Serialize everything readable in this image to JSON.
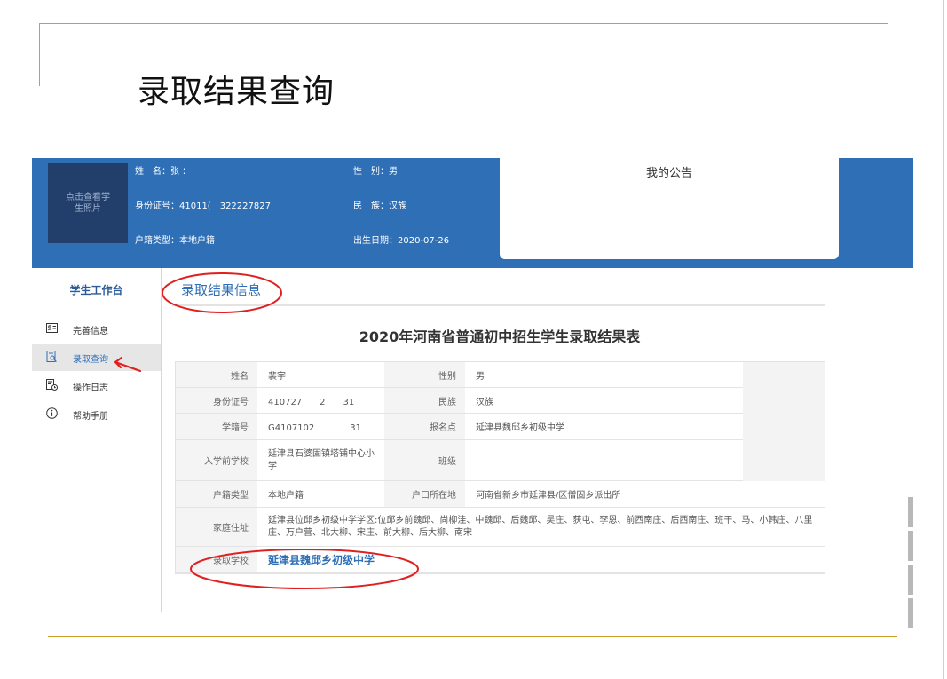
{
  "slide": {
    "title": "录取结果查询"
  },
  "banner": {
    "photo_label": "点击查看学\n生照片",
    "name": "姓　名：张 ：",
    "gender": "性　别：男",
    "id_number": "身份证号：41011(　322227827",
    "ethnicity": "民　族：汉族",
    "household_type": "户籍类型：本地户籍",
    "birth_date": "出生日期：2020-07-26",
    "notice_title": "我的公告"
  },
  "sidebar": {
    "title": "学生工作台",
    "items": [
      {
        "label": "完善信息",
        "icon": "profile-card-icon"
      },
      {
        "label": "录取查询",
        "icon": "search-document-icon"
      },
      {
        "label": "操作日志",
        "icon": "log-clock-icon"
      },
      {
        "label": "帮助手册",
        "icon": "info-circle-icon"
      }
    ]
  },
  "main": {
    "section_heading": "录取结果信息",
    "table_title": "2020年河南省普通初中招生学生录取结果表",
    "rows": {
      "name_label": "姓名",
      "name_value": "裴宇",
      "gender_label": "性别",
      "gender_value": "男",
      "id_label": "身份证号",
      "id_value": "410727　　2　　31",
      "ethnicity_label": "民族",
      "ethnicity_value": "汉族",
      "student_no_label": "学籍号",
      "student_no_value": "G4107102　　　　31",
      "signup_label": "报名点",
      "signup_value": "延津县魏邱乡初级中学",
      "prev_school_label": "入学前学校",
      "prev_school_value": "延津县石婆固镇塔铺中心小学",
      "class_label": "班级",
      "class_value": "",
      "household_label": "户籍类型",
      "household_value": "本地户籍",
      "hukou_label": "户口所在地",
      "hukou_value": "河南省新乡市延津县/区僧固乡派出所",
      "address_label": "家庭住址",
      "address_value": "延津县位邱乡初级中学学区:位邱乡前魏邱、尚柳洼、中魏邱、后魏邱、吴庄、获屯、李恩、前西南庄、后西南庄、班干、马、小韩庄、八里庄、万户营、北大柳、宋庄、前大柳、后大柳、南宋",
      "admit_label": "录取学校",
      "admit_value": "延津县魏邱乡初级中学"
    }
  },
  "colors": {
    "accent": "#2f6fb6",
    "gold_rule": "#c9a227",
    "annotation": "#e02020"
  }
}
